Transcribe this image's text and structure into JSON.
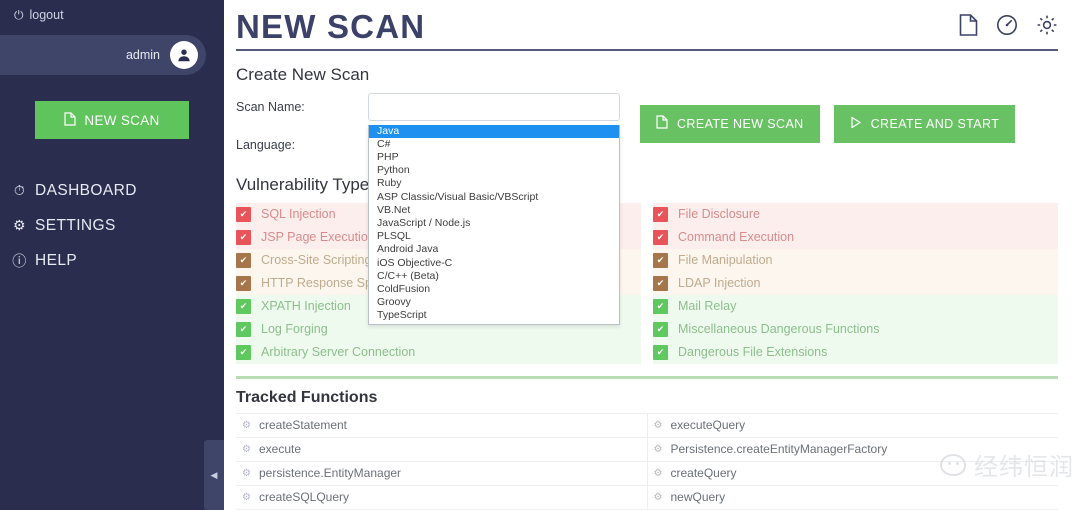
{
  "sidebar": {
    "logout": {
      "label": "logout",
      "icon": "power-icon"
    },
    "user": {
      "name": "admin",
      "icon": "user-avatar-icon"
    },
    "new_scan_button": {
      "label": "NEW SCAN",
      "icon": "document-icon"
    },
    "nav": [
      {
        "label": "DASHBOARD",
        "icon": "gauge-icon"
      },
      {
        "label": "SETTINGS",
        "icon": "gear-icon"
      },
      {
        "label": "HELP",
        "icon": "info-icon"
      }
    ],
    "collapse_handle": {
      "icon": "chevron-left-icon",
      "glyph": "◀"
    }
  },
  "header": {
    "title": "NEW SCAN",
    "icons": [
      {
        "name": "document-icon"
      },
      {
        "name": "gauge-icon"
      },
      {
        "name": "gear-icon"
      }
    ]
  },
  "form": {
    "heading": "Create New Scan",
    "scan_name": {
      "label": "Scan Name:",
      "value": "",
      "placeholder": ""
    },
    "language": {
      "label": "Language:",
      "selected": "Java",
      "caret": "▾"
    },
    "buttons": [
      {
        "label": "CREATE NEW SCAN",
        "icon": "document-icon",
        "glyph": "❐"
      },
      {
        "label": "CREATE AND START",
        "icon": "play-icon",
        "glyph": "▷"
      }
    ],
    "language_options": [
      "Java",
      "C#",
      "PHP",
      "Python",
      "Ruby",
      "ASP Classic/Visual Basic/VBScript",
      "VB.Net",
      "JavaScript / Node.js",
      "PLSQL",
      "Android Java",
      "iOS Objective-C",
      "C/C++ (Beta)",
      "ColdFusion",
      "Groovy",
      "TypeScript"
    ]
  },
  "vulnerability": {
    "heading": "Vulnerability Types",
    "left": [
      {
        "label": "SQL Injection",
        "level": "red",
        "checked": true
      },
      {
        "label": "JSP Page Execution",
        "level": "red",
        "checked": true
      },
      {
        "label": "Cross-Site Scripting",
        "level": "brown",
        "checked": true
      },
      {
        "label": "HTTP Response Splitting",
        "level": "brown",
        "checked": true
      },
      {
        "label": "XPATH Injection",
        "level": "green",
        "checked": true
      },
      {
        "label": "Log Forging",
        "level": "green",
        "checked": true
      },
      {
        "label": "Arbitrary Server Connection",
        "level": "green",
        "checked": true
      }
    ],
    "right": [
      {
        "label": "File Disclosure",
        "level": "red",
        "checked": true
      },
      {
        "label": "Command Execution",
        "level": "red",
        "checked": true
      },
      {
        "label": "File Manipulation",
        "level": "brown",
        "checked": true
      },
      {
        "label": "LDAP Injection",
        "level": "brown",
        "checked": true
      },
      {
        "label": "Mail Relay",
        "level": "green",
        "checked": true
      },
      {
        "label": "Miscellaneous Dangerous Functions",
        "level": "green",
        "checked": true
      },
      {
        "label": "Dangerous File Extensions",
        "level": "green",
        "checked": true
      }
    ],
    "check_glyph": "✔"
  },
  "tracked_functions": {
    "heading": "Tracked Functions",
    "icon": "gear-icon",
    "glyph": "⚙",
    "left": [
      "createStatement",
      "execute",
      "persistence.EntityManager",
      "createSQLQuery"
    ],
    "right": [
      "executeQuery",
      "Persistence.createEntityManagerFactory",
      "createQuery",
      "newQuery"
    ]
  },
  "watermark": {
    "text": "经纬恒润",
    "icon": "wechat-icon"
  },
  "colors": {
    "sidebar_bg": "#2b2d4e",
    "sidebar_user_bg": "#3f4469",
    "accent_green": "#60c45c",
    "title_navy": "#3b4167",
    "select_blue": "#1e90ef",
    "risk_high": "#e8545a",
    "risk_medium": "#a6764a",
    "risk_low": "#5fc85f"
  }
}
